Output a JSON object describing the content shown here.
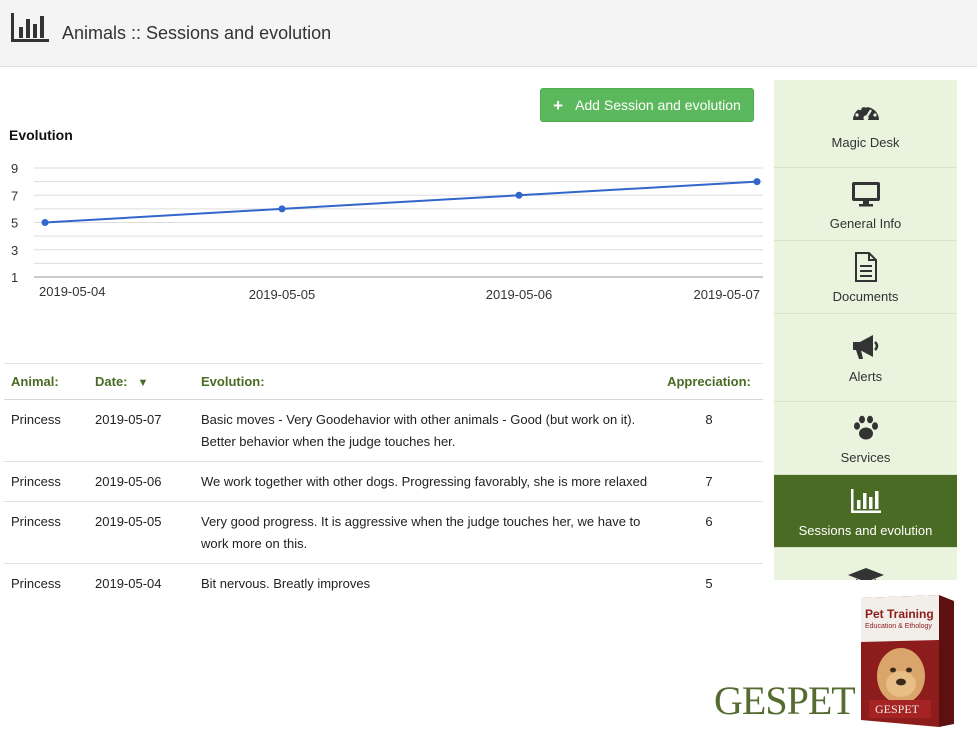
{
  "header": {
    "title": "Animals :: Sessions and evolution",
    "icon": "bar-chart-icon"
  },
  "actions": {
    "add_label": "Add Session and evolution",
    "add_icon": "plus-icon"
  },
  "chart_data": {
    "type": "line",
    "title": "Evolution",
    "x": [
      "2019-05-04",
      "2019-05-05",
      "2019-05-06",
      "2019-05-07"
    ],
    "series": [
      {
        "values": [
          5,
          6,
          7,
          8
        ],
        "color": "#3366cc"
      }
    ],
    "ylim": [
      1,
      9
    ],
    "yticks": [
      1,
      3,
      5,
      7,
      9
    ],
    "grid": true
  },
  "table": {
    "columns": {
      "animal": "Animal:",
      "date": "Date:",
      "evolution": "Evolution:",
      "appreciation": "Appreciation:"
    },
    "sort_icon": "sort-desc-icon",
    "rows": [
      {
        "animal": "Princess",
        "date": "2019-05-07",
        "evolution": "Basic moves - Very Goodehavior with other animals - Good (but work on it). Better behavior when the judge touches her.",
        "appreciation": "8"
      },
      {
        "animal": "Princess",
        "date": "2019-05-06",
        "evolution": "We work together with other dogs. Progressing favorably, she is more relaxed",
        "appreciation": "7"
      },
      {
        "animal": "Princess",
        "date": "2019-05-05",
        "evolution": "Very good progress. It is aggressive when the judge touches her, we have to work more on this.",
        "appreciation": "6"
      },
      {
        "animal": "Princess",
        "date": "2019-05-04",
        "evolution": "Bit nervous. Breatly improves",
        "appreciation": "5"
      }
    ]
  },
  "sidebar": {
    "items": [
      {
        "label": "Magic Desk",
        "icon": "dashboard-icon"
      },
      {
        "label": "General Info",
        "icon": "monitor-icon"
      },
      {
        "label": "Documents",
        "icon": "document-icon"
      },
      {
        "label": "Alerts",
        "icon": "megaphone-icon"
      },
      {
        "label": "Services",
        "icon": "paw-icon"
      },
      {
        "label": "Sessions and evolution",
        "icon": "bar-chart-icon",
        "active": true
      },
      {
        "label": "",
        "icon": "graduation-cap-icon"
      }
    ]
  },
  "branding": {
    "logo": "GESPET",
    "product_title": "Pet Training",
    "product_subtitle": "Education & Ethology",
    "product_logo": "GESPET"
  },
  "colors": {
    "accent": "#4a6b24",
    "button": "#5cb85c",
    "sidebar_bg": "#e9f3dd",
    "line": "#3366cc"
  }
}
